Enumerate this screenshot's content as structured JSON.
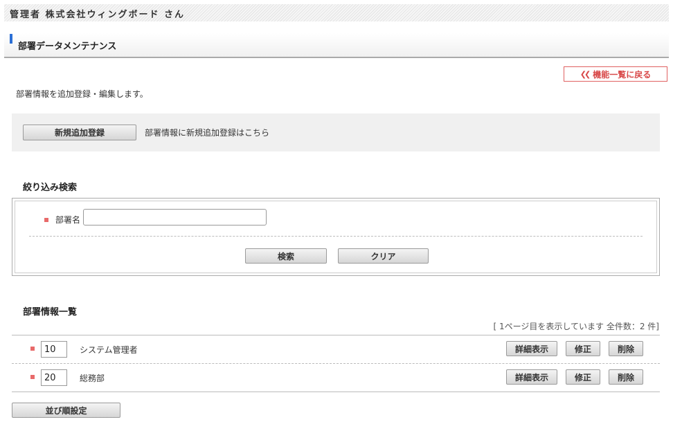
{
  "header": {
    "admin_label": "管理者 株式会社ウィングボード さん"
  },
  "page": {
    "title": "部署データメンテナンス",
    "back_label": "機能一覧に戻る",
    "description": "部署情報を追加登録・編集します。"
  },
  "new_entry": {
    "button_label": "新規追加登録",
    "note": "部署情報に新規追加登録はこちら"
  },
  "search": {
    "title": "絞り込み検索",
    "field_label": "部署名",
    "field_value": "",
    "search_label": "検索",
    "clear_label": "クリア"
  },
  "list": {
    "title": "部署情報一覧",
    "count_text": "[ 1ページ目を表示しています 全件数：2 件]",
    "rows": [
      {
        "order": "10",
        "name": "システム管理者"
      },
      {
        "order": "20",
        "name": "総務部"
      }
    ],
    "actions": {
      "detail": "詳細表示",
      "edit": "修正",
      "delete": "削除"
    },
    "sort_label": "並び順設定"
  },
  "colors": {
    "accent_blue": "#2b6fd6",
    "back_red": "#d84848",
    "bullet_red": "#e86a6a"
  },
  "icons": {
    "back": "double-chevron-left-icon"
  }
}
